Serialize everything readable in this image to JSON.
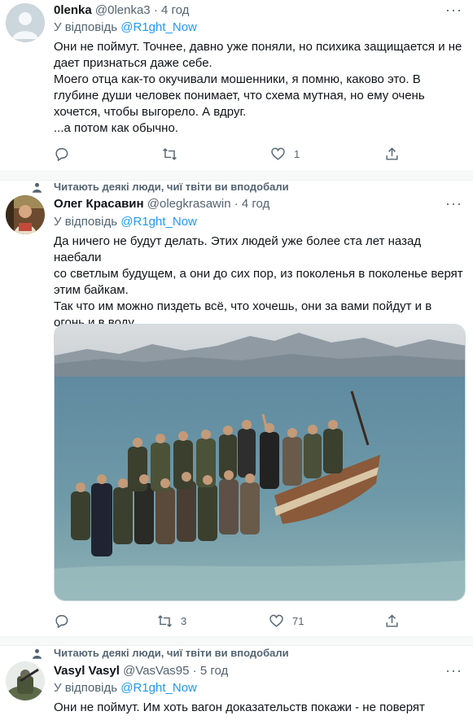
{
  "tweets": [
    {
      "name": "0lenka",
      "handle": "@0lenka3",
      "time": "4 год",
      "reply_prefix": "У відповідь",
      "reply_to": "@R1ght_Now",
      "lines": [
        "Они не поймут. Точнее, давно уже поняли, но психика защищается и не",
        "дает признаться даже себе.",
        "Моего отца как-то окучивали мошенники, я помню, каково это. В",
        "глубине души человек понимает, что схема мутная, но ему очень",
        "хочется, чтобы выгорело. А вдруг.",
        "...а потом как обычно."
      ],
      "reply_count": "",
      "retweet_count": "",
      "like_count": "1"
    },
    {
      "social_context": "Читають деякі люди, чиї твіти ви вподобали",
      "name": "Олег Красавин",
      "handle": "@olegkrasawin",
      "time": "4 год",
      "reply_prefix": "У відповідь",
      "reply_to": "@R1ght_Now",
      "lines": [
        "Да ничего не будут делать. Этих людей уже более ста лет назад наебали",
        "со светлым будущем, а они до сих пор, из поколенья в поколенье верят",
        "этим байкам.",
        "Так что им можно пиздеть всё, что хочешь, они за вами пойдут и в",
        "огонь и в воду."
      ],
      "reply_count": "",
      "retweet_count": "3",
      "like_count": "71"
    },
    {
      "social_context": "Читають деякі люди, чиї твіти ви вподобали",
      "name": "Vasyl Vasyl",
      "handle": "@VasVas95",
      "time": "5 год",
      "reply_prefix": "У відповідь",
      "reply_to": "@R1ght_Now",
      "lines": [
        "Они не поймут. Им хоть вагон доказательств покажи - не поверят"
      ]
    }
  ],
  "icons": {
    "reply": "reply-icon",
    "retweet": "retweet-icon",
    "like": "heart-icon",
    "share": "share-icon",
    "more": "more-icon",
    "social": "person-icon"
  },
  "colors": {
    "link": "#1d9bf0",
    "secondary": "#536471",
    "separator": "#f7f9f9"
  }
}
